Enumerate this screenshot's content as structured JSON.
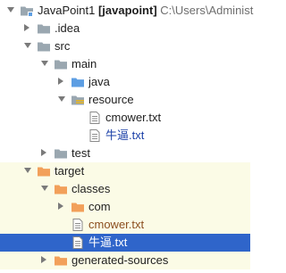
{
  "project": {
    "name": "JavaPoint1",
    "module": "[javapoint]",
    "path": "C:\\Users\\Administ"
  },
  "tree": [
    {
      "label": "JavaPoint1",
      "depth": 0,
      "expanded": true,
      "icon": "module-folder-icon",
      "is_root": true
    },
    {
      "label": ".idea",
      "depth": 1,
      "expanded": false,
      "icon": "folder-icon"
    },
    {
      "label": "src",
      "depth": 1,
      "expanded": true,
      "icon": "folder-icon"
    },
    {
      "label": "main",
      "depth": 2,
      "expanded": true,
      "icon": "folder-icon"
    },
    {
      "label": "java",
      "depth": 3,
      "expanded": false,
      "icon": "source-folder-icon"
    },
    {
      "label": "resource",
      "depth": 3,
      "expanded": true,
      "icon": "resource-folder-icon"
    },
    {
      "label": "cmower.txt",
      "depth": 4,
      "icon": "text-file-icon"
    },
    {
      "label": "牛逼.txt",
      "depth": 4,
      "icon": "text-file-icon",
      "color": "link"
    },
    {
      "label": "test",
      "depth": 2,
      "expanded": false,
      "icon": "folder-icon"
    },
    {
      "label": "target",
      "depth": 1,
      "expanded": true,
      "icon": "excluded-folder-icon",
      "excluded": true
    },
    {
      "label": "classes",
      "depth": 2,
      "expanded": true,
      "icon": "excluded-folder-icon",
      "excluded": true
    },
    {
      "label": "com",
      "depth": 3,
      "expanded": false,
      "icon": "excluded-folder-icon",
      "excluded": true
    },
    {
      "label": "cmower.txt",
      "depth": 3,
      "icon": "text-file-icon",
      "excluded": true,
      "color": "excluded"
    },
    {
      "label": "牛逼.txt",
      "depth": 3,
      "icon": "text-file-icon",
      "excluded": true,
      "selected": true
    },
    {
      "label": "generated-sources",
      "depth": 2,
      "expanded": false,
      "icon": "excluded-folder-icon",
      "excluded": true
    }
  ],
  "colors": {
    "folder": "#9aa7b0",
    "source_folder": "#5d9ee3",
    "excluded_folder": "#f2a05a",
    "resource_stripes": "#e6b422",
    "selection": "#2f65ca",
    "excluded_row": "#fbfbe6"
  }
}
